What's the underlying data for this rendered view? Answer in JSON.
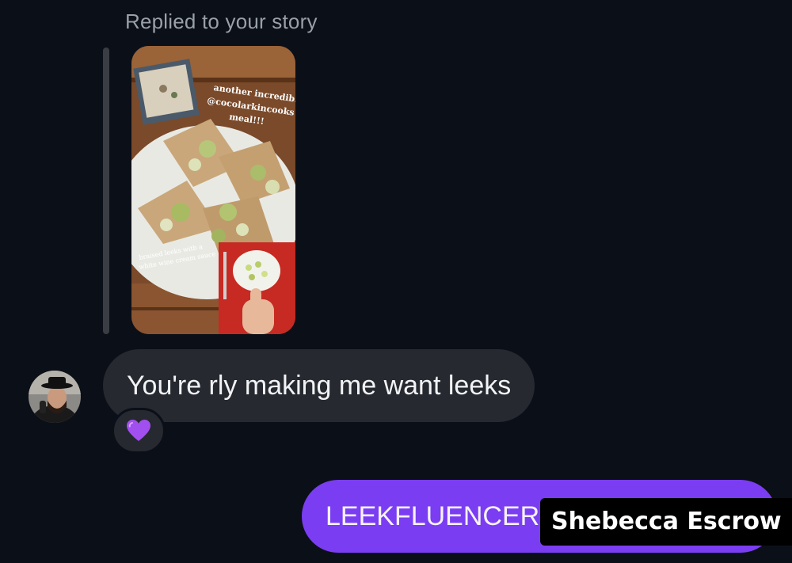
{
  "conversation": {
    "reply_context": {
      "label": "Replied to your story",
      "story_overlay": {
        "caption_top": "another incredible @cocolarkincooks meal!!!",
        "caption_bottom": "braised leeks with a white wine cream sauce"
      }
    },
    "messages": [
      {
        "direction": "incoming",
        "text": "You're rly making me want leeks",
        "reaction": "💜"
      },
      {
        "direction": "outgoing",
        "text": "LEEKFLUENCER"
      }
    ]
  },
  "watermark": {
    "text": "Shebecca Escrow"
  },
  "colors": {
    "background": "#0b0f18",
    "incoming_bubble": "#262930",
    "outgoing_bubble": "#7a3df2",
    "reply_label": "#9aa0a8"
  },
  "icons": {
    "avatar": "user-avatar",
    "reaction": "purple-heart"
  }
}
